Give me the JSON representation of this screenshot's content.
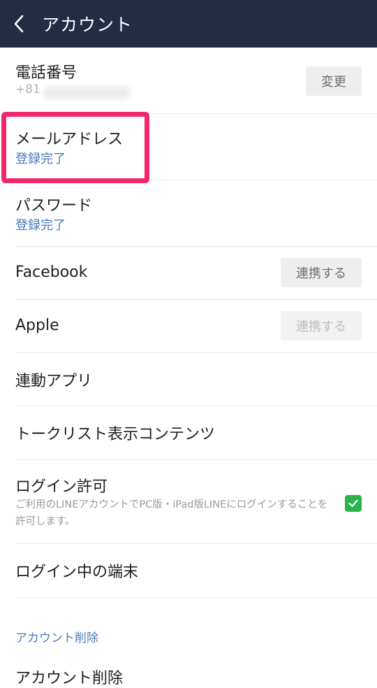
{
  "header": {
    "back_icon": "chevron-left-icon",
    "title": "アカウント"
  },
  "rows": {
    "phone": {
      "label": "電話番号",
      "value": "+81",
      "button": "変更"
    },
    "email": {
      "label": "メールアドレス",
      "status": "登録完了"
    },
    "password": {
      "label": "パスワード",
      "status": "登録完了"
    },
    "facebook": {
      "label": "Facebook",
      "button": "連携する"
    },
    "apple": {
      "label": "Apple",
      "button": "連携する"
    },
    "linked_apps": {
      "label": "連動アプリ"
    },
    "talk_list": {
      "label": "トークリスト表示コンテンツ"
    },
    "login_permission": {
      "label": "ログイン許可",
      "description": "ご利用のLINEアカウントでPC版・iPad版LINEにログインすることを許可します。",
      "checked": true
    },
    "logged_in_devices": {
      "label": "ログイン中の端末"
    }
  },
  "delete_section": {
    "heading": "アカウント削除",
    "item_label": "アカウント削除"
  },
  "colors": {
    "header_bg": "#232b45",
    "link_blue": "#4a78bd",
    "highlight": "#f0266e",
    "check_green": "#2ab34a"
  }
}
